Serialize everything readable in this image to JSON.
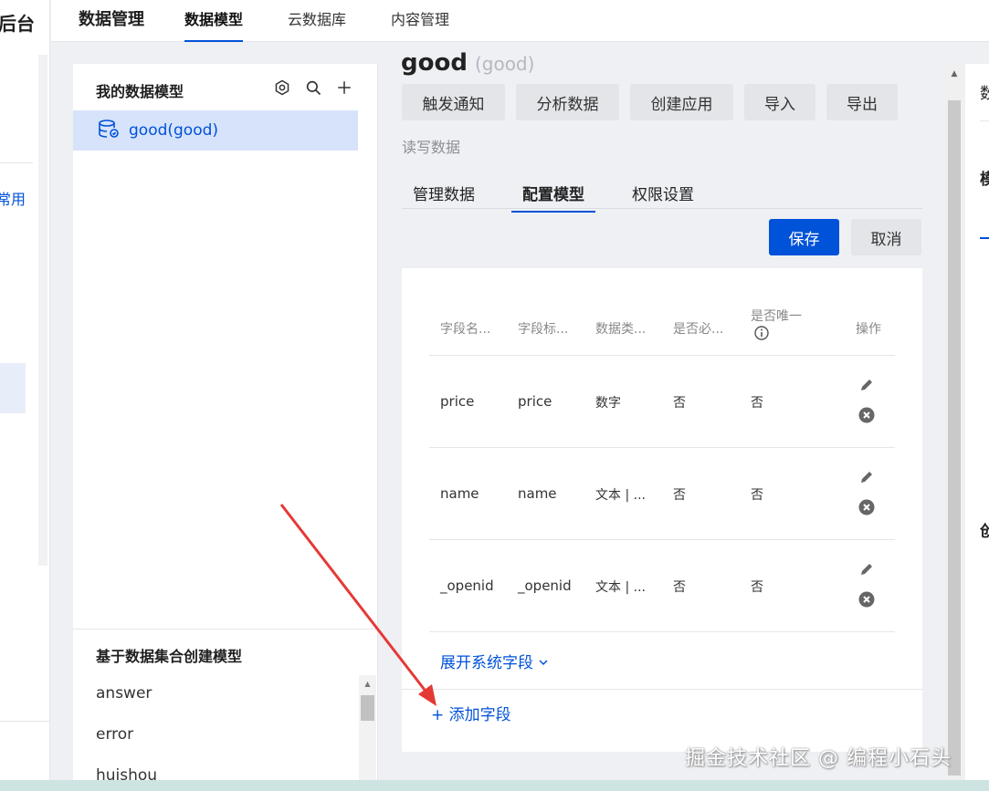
{
  "left_sidebar": {
    "brand_fragment": "后台",
    "common_fragment": "常用"
  },
  "topnav": {
    "title": "数据管理",
    "tabs": [
      {
        "label": "数据模型",
        "active": true
      },
      {
        "label": "云数据库",
        "active": false
      },
      {
        "label": "内容管理",
        "active": false
      }
    ]
  },
  "models_panel": {
    "title": "我的数据模型",
    "icons": [
      "settings-icon",
      "search-icon",
      "add-icon"
    ],
    "items": [
      {
        "label": "good(good)",
        "selected": true,
        "icon": "database-icon"
      }
    ],
    "collection_title": "基于数据集合创建模型",
    "collections": [
      "answer",
      "error",
      "huishou"
    ]
  },
  "model": {
    "name": "good",
    "name_sub": "(good)",
    "actions": [
      "触发通知",
      "分析数据",
      "创建应用",
      "导入",
      "导出"
    ],
    "permission_text": "读写数据",
    "tabs": [
      {
        "label": "管理数据",
        "active": false
      },
      {
        "label": "配置模型",
        "active": true
      },
      {
        "label": "权限设置",
        "active": false
      }
    ],
    "save_label": "保存",
    "cancel_label": "取消"
  },
  "fields_table": {
    "columns": [
      "字段名...",
      "字段标...",
      "数据类...",
      "是否必...",
      "是否唯一",
      "操作"
    ],
    "rows": [
      {
        "name": "price",
        "label": "price",
        "type": "数字",
        "required": "否",
        "unique": "否"
      },
      {
        "name": "name",
        "label": "name",
        "type": "文本 | ...",
        "required": "否",
        "unique": "否"
      },
      {
        "name": "_openid",
        "label": "_openid",
        "type": "文本 | ...",
        "required": "否",
        "unique": "否"
      }
    ],
    "expand_label": "展开系统字段",
    "add_field_label": "+ 添加字段"
  },
  "right_panel": {
    "fragments": [
      "数",
      "模",
      "创"
    ]
  },
  "watermark": "掘金技术社区 @ 编程小石头",
  "colors": {
    "accent": "#0052d9",
    "annotation_arrow": "#e53935"
  }
}
